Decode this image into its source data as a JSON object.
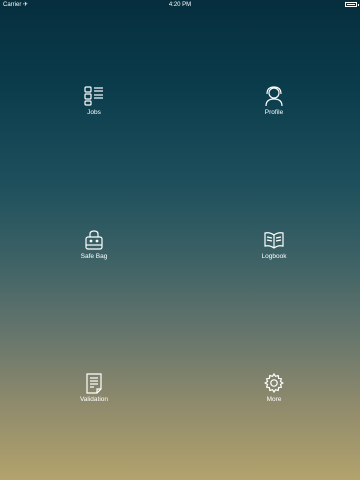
{
  "status_bar": {
    "carrier": "Carrier ✈",
    "time": "4:20 PM",
    "battery_icon": "battery-icon"
  },
  "menu": [
    {
      "label": "Jobs",
      "icon": "jobs-list-icon"
    },
    {
      "label": "Profile",
      "icon": "profile-user-icon"
    },
    {
      "label": "Safe Bag",
      "icon": "safe-bag-icon"
    },
    {
      "label": "Logbook",
      "icon": "logbook-icon"
    },
    {
      "label": "Validation",
      "icon": "validation-document-icon"
    },
    {
      "label": "More",
      "icon": "gear-icon"
    }
  ],
  "colors": {
    "gradient_top": "#062e3d",
    "gradient_bottom": "#b3a36d",
    "text": "#ffffff"
  }
}
